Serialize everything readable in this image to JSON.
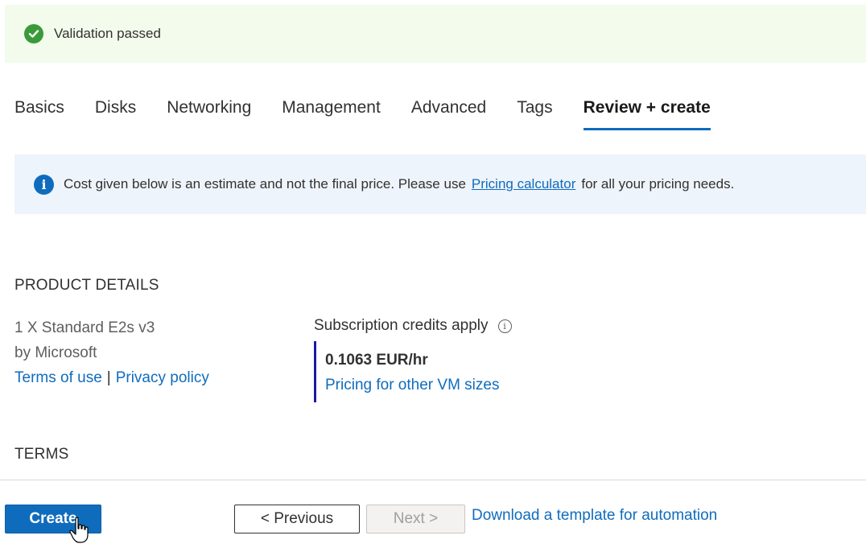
{
  "validation": {
    "text": "Validation passed",
    "icon": "checkmark-circle-icon",
    "color": "#3a9a3a"
  },
  "tabs": [
    {
      "label": "Basics",
      "active": false
    },
    {
      "label": "Disks",
      "active": false
    },
    {
      "label": "Networking",
      "active": false
    },
    {
      "label": "Management",
      "active": false
    },
    {
      "label": "Advanced",
      "active": false
    },
    {
      "label": "Tags",
      "active": false
    },
    {
      "label": "Review + create",
      "active": true
    }
  ],
  "info_bar": {
    "icon": "info-icon",
    "text_before": "Cost given below is an estimate and not the final price. Please use",
    "link": "Pricing calculator",
    "text_after": "for all your pricing needs."
  },
  "product_details": {
    "heading": "PRODUCT DETAILS",
    "product_name": "1 X Standard E2s v3",
    "publisher": "by Microsoft",
    "terms_link": "Terms of use",
    "separator": "|",
    "privacy_link": "Privacy policy",
    "credits_label": "Subscription credits apply",
    "price": "0.1063 EUR/hr",
    "pricing_link": "Pricing for other VM sizes"
  },
  "terms": {
    "heading": "TERMS"
  },
  "footer": {
    "create_label": "Create",
    "previous_label": "< Previous",
    "next_label": "Next >",
    "download_link": "Download a template for automation"
  },
  "colors": {
    "accent": "#0f6cbd",
    "success_bg": "#f2fbec",
    "info_bg": "#eef4fb"
  }
}
